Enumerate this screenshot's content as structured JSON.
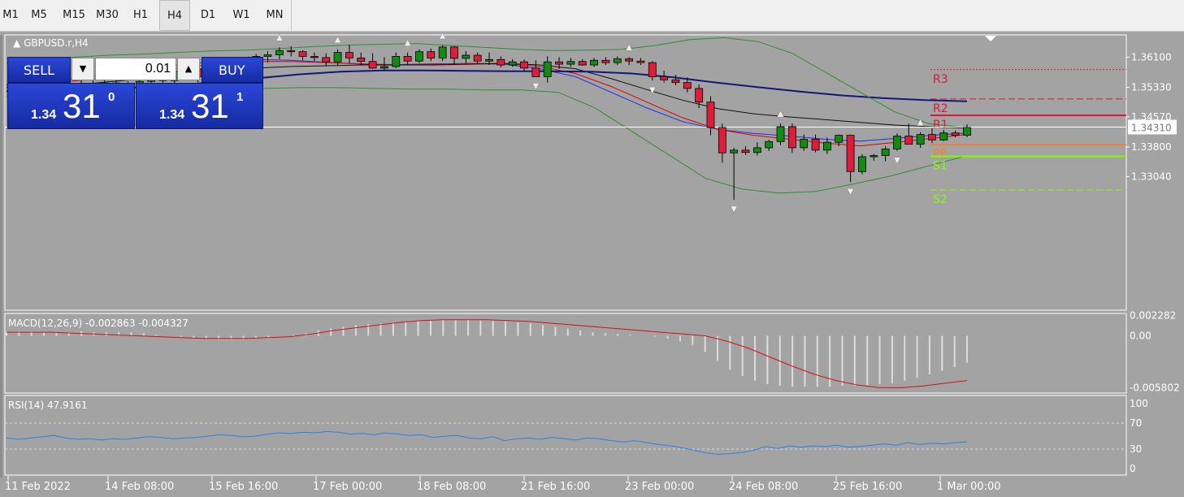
{
  "timeframes": [
    "M1",
    "M5",
    "M15",
    "M30",
    "H1",
    "H4",
    "D1",
    "W1",
    "MN"
  ],
  "active_timeframe": "H4",
  "symbol_label": "GBPUSD.r,H4",
  "trade_panel": {
    "sell_label": "SELL",
    "buy_label": "BUY",
    "lot": "0.01",
    "sell_big": "1.34",
    "sell_pips": "31",
    "sell_sup": "0",
    "buy_big": "1.34",
    "buy_pips": "31",
    "buy_sup": "1"
  },
  "colors": {
    "bg": "#a3a3a3",
    "bull": "#118b11",
    "bear": "#dc1e3a",
    "ema_fast": "#1e2ee8",
    "ema_mid": "#e00000",
    "ema_slow": "#111111",
    "ma_long": "#15157a",
    "bands": "#2f8f2f",
    "r_level": "#d81a3a",
    "pp": "#ff7a2a",
    "s_level": "#7dff00",
    "macd_signal": "#d81010",
    "macd_hist": "#dcdcdc",
    "rsi": "#2a82e4"
  },
  "chart_data": [
    {
      "type": "candlestick",
      "title": "GBPUSD.r,H4",
      "ylim": [
        1.2962,
        1.3667
      ],
      "yticks": [
        "1.36100",
        "1.35330",
        "1.34570",
        "1.33800",
        "1.33040"
      ],
      "current_price": "1.34310",
      "x_labels": [
        "11 Feb 2022",
        "14 Feb 08:00",
        "15 Feb 16:00",
        "17 Feb 00:00",
        "18 Feb 08:00",
        "21 Feb 16:00",
        "23 Feb 00:00",
        "24 Feb 08:00",
        "25 Feb 16:00",
        "1 Mar 00:00"
      ],
      "candles": [
        [
          1.3555,
          1.3566,
          1.3532,
          1.3543
        ],
        [
          1.3543,
          1.356,
          1.352,
          1.3552
        ],
        [
          1.3552,
          1.3565,
          1.3538,
          1.3546
        ],
        [
          1.3546,
          1.356,
          1.3528,
          1.355
        ],
        [
          1.355,
          1.357,
          1.354,
          1.3535
        ],
        [
          1.3535,
          1.3548,
          1.3522,
          1.3542
        ],
        [
          1.3542,
          1.3556,
          1.353,
          1.3538
        ],
        [
          1.3538,
          1.355,
          1.3488,
          1.3513
        ],
        [
          1.3513,
          1.3552,
          1.3502,
          1.3544
        ],
        [
          1.3544,
          1.3558,
          1.352,
          1.3528
        ],
        [
          1.3528,
          1.3548,
          1.352,
          1.3538
        ],
        [
          1.3538,
          1.3556,
          1.351,
          1.3548
        ],
        [
          1.3548,
          1.357,
          1.3535,
          1.3556
        ],
        [
          1.3556,
          1.3566,
          1.3462,
          1.355
        ],
        [
          1.355,
          1.3584,
          1.354,
          1.3574
        ],
        [
          1.3574,
          1.3592,
          1.3556,
          1.358
        ],
        [
          1.358,
          1.3594,
          1.3546,
          1.356
        ],
        [
          1.356,
          1.3592,
          1.3552,
          1.3578
        ],
        [
          1.3578,
          1.359,
          1.356,
          1.3574
        ],
        [
          1.3574,
          1.3608,
          1.356,
          1.3596
        ],
        [
          1.3596,
          1.3606,
          1.358,
          1.359
        ],
        [
          1.359,
          1.3618,
          1.3582,
          1.3612
        ],
        [
          1.3612,
          1.3625,
          1.3596,
          1.3616
        ],
        [
          1.3616,
          1.3635,
          1.3605,
          1.3627
        ],
        [
          1.3627,
          1.3638,
          1.3612,
          1.3624
        ],
        [
          1.3624,
          1.3628,
          1.3602,
          1.3612
        ],
        [
          1.3612,
          1.3622,
          1.36,
          1.3609
        ],
        [
          1.3609,
          1.362,
          1.3588,
          1.3598
        ],
        [
          1.3598,
          1.363,
          1.359,
          1.3622
        ],
        [
          1.3622,
          1.3642,
          1.3595,
          1.3608
        ],
        [
          1.3608,
          1.3622,
          1.359,
          1.3599
        ],
        [
          1.3599,
          1.362,
          1.358,
          1.3582
        ],
        [
          1.3582,
          1.361,
          1.3575,
          1.3586
        ],
        [
          1.3586,
          1.3622,
          1.3582,
          1.3612
        ],
        [
          1.3612,
          1.3622,
          1.359,
          1.36
        ],
        [
          1.36,
          1.363,
          1.3595,
          1.3624
        ],
        [
          1.3624,
          1.3632,
          1.36,
          1.3608
        ],
        [
          1.3608,
          1.364,
          1.36,
          1.3636
        ],
        [
          1.3636,
          1.3638,
          1.359,
          1.3607
        ],
        [
          1.3607,
          1.3625,
          1.3595,
          1.3615
        ],
        [
          1.3615,
          1.3622,
          1.3595,
          1.36
        ],
        [
          1.36,
          1.3622,
          1.359,
          1.3604
        ],
        [
          1.3604,
          1.3612,
          1.3584,
          1.359
        ],
        [
          1.359,
          1.3605,
          1.3585,
          1.3598
        ],
        [
          1.3598,
          1.3604,
          1.3575,
          1.3582
        ],
        [
          1.3582,
          1.3602,
          1.356,
          1.356
        ],
        [
          1.356,
          1.3612,
          1.3545,
          1.3598
        ],
        [
          1.3598,
          1.361,
          1.358,
          1.3592
        ],
        [
          1.3592,
          1.3608,
          1.3585,
          1.3599
        ],
        [
          1.3599,
          1.3605,
          1.3588,
          1.359
        ],
        [
          1.359,
          1.3608,
          1.3585,
          1.3602
        ],
        [
          1.3602,
          1.361,
          1.359,
          1.3596
        ],
        [
          1.3596,
          1.3612,
          1.359,
          1.3606
        ],
        [
          1.3606,
          1.361,
          1.359,
          1.36
        ],
        [
          1.36,
          1.3608,
          1.359,
          1.3596
        ],
        [
          1.3596,
          1.36,
          1.355,
          1.356
        ],
        [
          1.356,
          1.3575,
          1.3545,
          1.3552
        ],
        [
          1.3552,
          1.3565,
          1.3538,
          1.3545
        ],
        [
          1.3545,
          1.3558,
          1.352,
          1.353
        ],
        [
          1.353,
          1.354,
          1.348,
          1.3495
        ],
        [
          1.3495,
          1.351,
          1.341,
          1.343
        ],
        [
          1.343,
          1.344,
          1.334,
          1.3365
        ],
        [
          1.3365,
          1.3378,
          1.3245,
          1.3372
        ],
        [
          1.3372,
          1.3382,
          1.336,
          1.3366
        ],
        [
          1.3366,
          1.3392,
          1.3358,
          1.3378
        ],
        [
          1.3378,
          1.3398,
          1.337,
          1.3394
        ],
        [
          1.3394,
          1.344,
          1.3385,
          1.3432
        ],
        [
          1.3432,
          1.344,
          1.3365,
          1.3378
        ],
        [
          1.3378,
          1.3412,
          1.337,
          1.34
        ],
        [
          1.34,
          1.3412,
          1.3366,
          1.3372
        ],
        [
          1.3372,
          1.3404,
          1.3362,
          1.3392
        ],
        [
          1.3392,
          1.3412,
          1.3382,
          1.341
        ],
        [
          1.341,
          1.3412,
          1.329,
          1.3317
        ],
        [
          1.3317,
          1.3362,
          1.331,
          1.3355
        ],
        [
          1.3355,
          1.3362,
          1.3345,
          1.3358
        ],
        [
          1.3358,
          1.3382,
          1.3343,
          1.3375
        ],
        [
          1.3375,
          1.3415,
          1.337,
          1.3408
        ],
        [
          1.3408,
          1.344,
          1.3392,
          1.3387
        ],
        [
          1.3387,
          1.3418,
          1.3378,
          1.3412
        ],
        [
          1.3412,
          1.3428,
          1.339,
          1.3398
        ],
        [
          1.3398,
          1.3424,
          1.3395,
          1.3416
        ],
        [
          1.3416,
          1.3422,
          1.3405,
          1.341
        ],
        [
          1.341,
          1.3438,
          1.3405,
          1.343
        ]
      ],
      "pivot_levels": [
        {
          "name": "R3",
          "value": 1.3578,
          "style": "dotted",
          "color": "#d81a3a"
        },
        {
          "name": "R2",
          "value": 1.3503,
          "style": "dashed",
          "color": "#d81a3a"
        },
        {
          "name": "R1",
          "value": 1.3461,
          "style": "solid",
          "color": "#d81a3a"
        },
        {
          "name": "PP",
          "value": 1.3386,
          "style": "solid",
          "color": "#ff7a2a"
        },
        {
          "name": "S1",
          "value": 1.3356,
          "style": "solid",
          "color": "#7dff00"
        },
        {
          "name": "S2",
          "value": 1.327,
          "style": "dashed",
          "color": "#7dff00"
        }
      ]
    },
    {
      "type": "bar",
      "title": "MACD(12,26,9) -0.002863 -0.004327",
      "ylim": [
        -0.0064,
        0.0025
      ],
      "yticks": [
        "0.002282",
        "0.00",
        "-0.005802"
      ],
      "histogram": [
        0.0005,
        0.0005,
        0.0005,
        0.0004,
        0.0004,
        0.0004,
        0.0005,
        0.0004,
        0.0004,
        0.0004,
        0.0004,
        0.0003,
        0.0001,
        0.0,
        -0.0001,
        -0.0002,
        -0.0003,
        -0.0004,
        -0.0004,
        -0.0004,
        -0.0003,
        -0.0002,
        0.0,
        0.0001,
        0.0003,
        0.0006,
        0.0008,
        0.001,
        0.0012,
        0.0013,
        0.0014,
        0.0015,
        0.0016,
        0.0017,
        0.0018,
        0.0018,
        0.0018,
        0.0018,
        0.0017,
        0.0017,
        0.0016,
        0.0015,
        0.0014,
        0.0012,
        0.001,
        0.0008,
        0.0006,
        0.0004,
        0.0003,
        0.0002,
        0.0001,
        0.0,
        -0.0001,
        -0.0003,
        -0.0006,
        -0.001,
        -0.0018,
        -0.0028,
        -0.0038,
        -0.0045,
        -0.005,
        -0.0054,
        -0.0056,
        -0.0057,
        -0.0057,
        -0.0057,
        -0.0057,
        -0.0056,
        -0.0056,
        -0.0055,
        -0.0054,
        -0.0053,
        -0.005,
        -0.0047,
        -0.0043,
        -0.0039,
        -0.0035,
        -0.003
      ],
      "signal": [
        0.0004,
        0.0004,
        0.0004,
        0.0003,
        0.0002,
        0.0001,
        0.0,
        -0.0001,
        -0.0002,
        -0.0003,
        -0.0003,
        -0.0003,
        -0.0002,
        -0.0001,
        0.0002,
        0.0006,
        0.0009,
        0.0012,
        0.0015,
        0.0017,
        0.0018,
        0.0018,
        0.0018,
        0.0017,
        0.0016,
        0.0014,
        0.0012,
        0.001,
        0.0008,
        0.0006,
        0.0004,
        0.0002,
        0.0,
        -0.0006,
        -0.0014,
        -0.0024,
        -0.0034,
        -0.0043,
        -0.005,
        -0.0055,
        -0.0058,
        -0.0058,
        -0.0056,
        -0.0053,
        -0.005
      ]
    },
    {
      "type": "line",
      "title": "RSI(14) 47.9161",
      "ylim": [
        0,
        100
      ],
      "yticks": [
        "100",
        "70",
        "30",
        "0"
      ],
      "levels": [
        70,
        30
      ],
      "values": [
        47,
        45,
        47,
        49,
        51,
        47,
        45,
        46,
        44,
        46,
        45,
        47,
        49,
        48,
        46,
        47,
        48,
        50,
        52,
        51,
        49,
        50,
        53,
        55,
        54,
        56,
        55,
        57,
        56,
        53,
        54,
        52,
        55,
        53,
        51,
        52,
        48,
        50,
        51,
        47,
        46,
        49,
        43,
        46,
        47,
        45,
        48,
        46,
        44,
        47,
        46,
        43,
        41,
        43,
        40,
        37,
        35,
        32,
        28,
        24,
        22,
        23,
        25,
        28,
        34,
        31,
        35,
        33,
        35,
        34,
        36,
        33,
        34,
        36,
        38,
        36,
        40,
        37,
        39,
        38,
        40,
        41
      ]
    },
    {
      "type": "line",
      "title": "Overlay indicators",
      "series": [
        {
          "color": "#1e2ee8",
          "values": [
            1.354,
            1.3547,
            1.3556,
            1.3568,
            1.3582,
            1.3592,
            1.3599,
            1.3604,
            1.3602,
            1.3597,
            1.3592,
            1.3591,
            1.3593,
            1.3594,
            1.3592,
            1.358,
            1.356,
            1.352,
            1.348,
            1.3445,
            1.3425,
            1.3415,
            1.3408,
            1.34,
            1.3395,
            1.3402,
            1.341,
            1.3416
          ]
        },
        {
          "color": "#e00000",
          "values": [
            1.3538,
            1.3542,
            1.355,
            1.356,
            1.3572,
            1.3584,
            1.3593,
            1.3599,
            1.3599,
            1.3596,
            1.3593,
            1.359,
            1.3592,
            1.3594,
            1.3594,
            1.3586,
            1.3568,
            1.3535,
            1.3495,
            1.3455,
            1.3425,
            1.341,
            1.34,
            1.339,
            1.3383,
            1.3392,
            1.3402,
            1.3412
          ]
        },
        {
          "color": "#111111",
          "values": [
            1.3532,
            1.3535,
            1.354,
            1.3548,
            1.3556,
            1.3566,
            1.3576,
            1.3582,
            1.3586,
            1.3588,
            1.359,
            1.359,
            1.359,
            1.3592,
            1.3594,
            1.359,
            1.358,
            1.3555,
            1.3527,
            1.35,
            1.3478,
            1.3465,
            1.3457,
            1.345,
            1.3443,
            1.3436,
            1.3432,
            1.3428
          ]
        },
        {
          "color": "#15157a",
          "values": [
            1.3523,
            1.3524,
            1.3528,
            1.3532,
            1.3538,
            1.3546,
            1.3556,
            1.3566,
            1.3573,
            1.3576,
            1.3576,
            1.3575,
            1.3574,
            1.3574,
            1.3573,
            1.3568,
            1.3558,
            1.3545,
            1.3533,
            1.3522,
            1.3512,
            1.3505,
            1.35,
            1.3497
          ]
        },
        {
          "color": "#2f8f2f",
          "values": [
            1.3595,
            1.3604,
            1.361,
            1.3615,
            1.3618,
            1.3622,
            1.3626,
            1.3628,
            1.3632,
            1.3637,
            1.3641,
            1.3643,
            1.3645,
            1.364,
            1.3635,
            1.363,
            1.3627,
            1.3628,
            1.363,
            1.364,
            1.3655,
            1.366,
            1.365,
            1.362,
            1.357,
            1.352,
            1.347,
            1.344,
            1.343
          ]
        },
        {
          "color": "#2f8f2f",
          "values": [
            1.351,
            1.3512,
            1.3516,
            1.3518,
            1.3522,
            1.3524,
            1.3528,
            1.353,
            1.3532,
            1.3532,
            1.353,
            1.3528,
            1.3528,
            1.3526,
            1.3526,
            1.352,
            1.348,
            1.342,
            1.336,
            1.33,
            1.3272,
            1.3262,
            1.3266,
            1.3285,
            1.3305,
            1.333,
            1.3355
          ]
        }
      ]
    }
  ]
}
